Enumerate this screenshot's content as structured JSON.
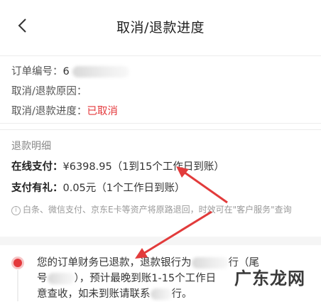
{
  "header": {
    "title": "取消/退款进度"
  },
  "order": {
    "number_label": "订单编号：",
    "number_visible": "6",
    "reason_label": "取消/退款原因：",
    "progress_label": "取消/退款进度：",
    "progress_value": "已取消"
  },
  "refund": {
    "section_title": "退款明细",
    "online_label": "在线支付：",
    "online_value": "¥6398.95（1到15个工作日到账）",
    "gift_label": "支付有礼：",
    "gift_value": "0.05元（1个工作日到账）",
    "notice": "白条、微信支付、京东E卡等资产将原路退回，时效可在\"客户服务\"查询"
  },
  "timeline": {
    "line1_a": "您的订单财务已退款，退款银行为",
    "line1_b": "行（尾",
    "line2_a": "号",
    "line2_b": "），预计最晚到账1-15个工作日",
    "line2_c": "",
    "line3_a": "意查收，如未到账请联系",
    "line3_b": "行。"
  },
  "watermark": "广东龙网",
  "colors": {
    "accent": "#e4393c",
    "arrow": "#e23b3b"
  }
}
